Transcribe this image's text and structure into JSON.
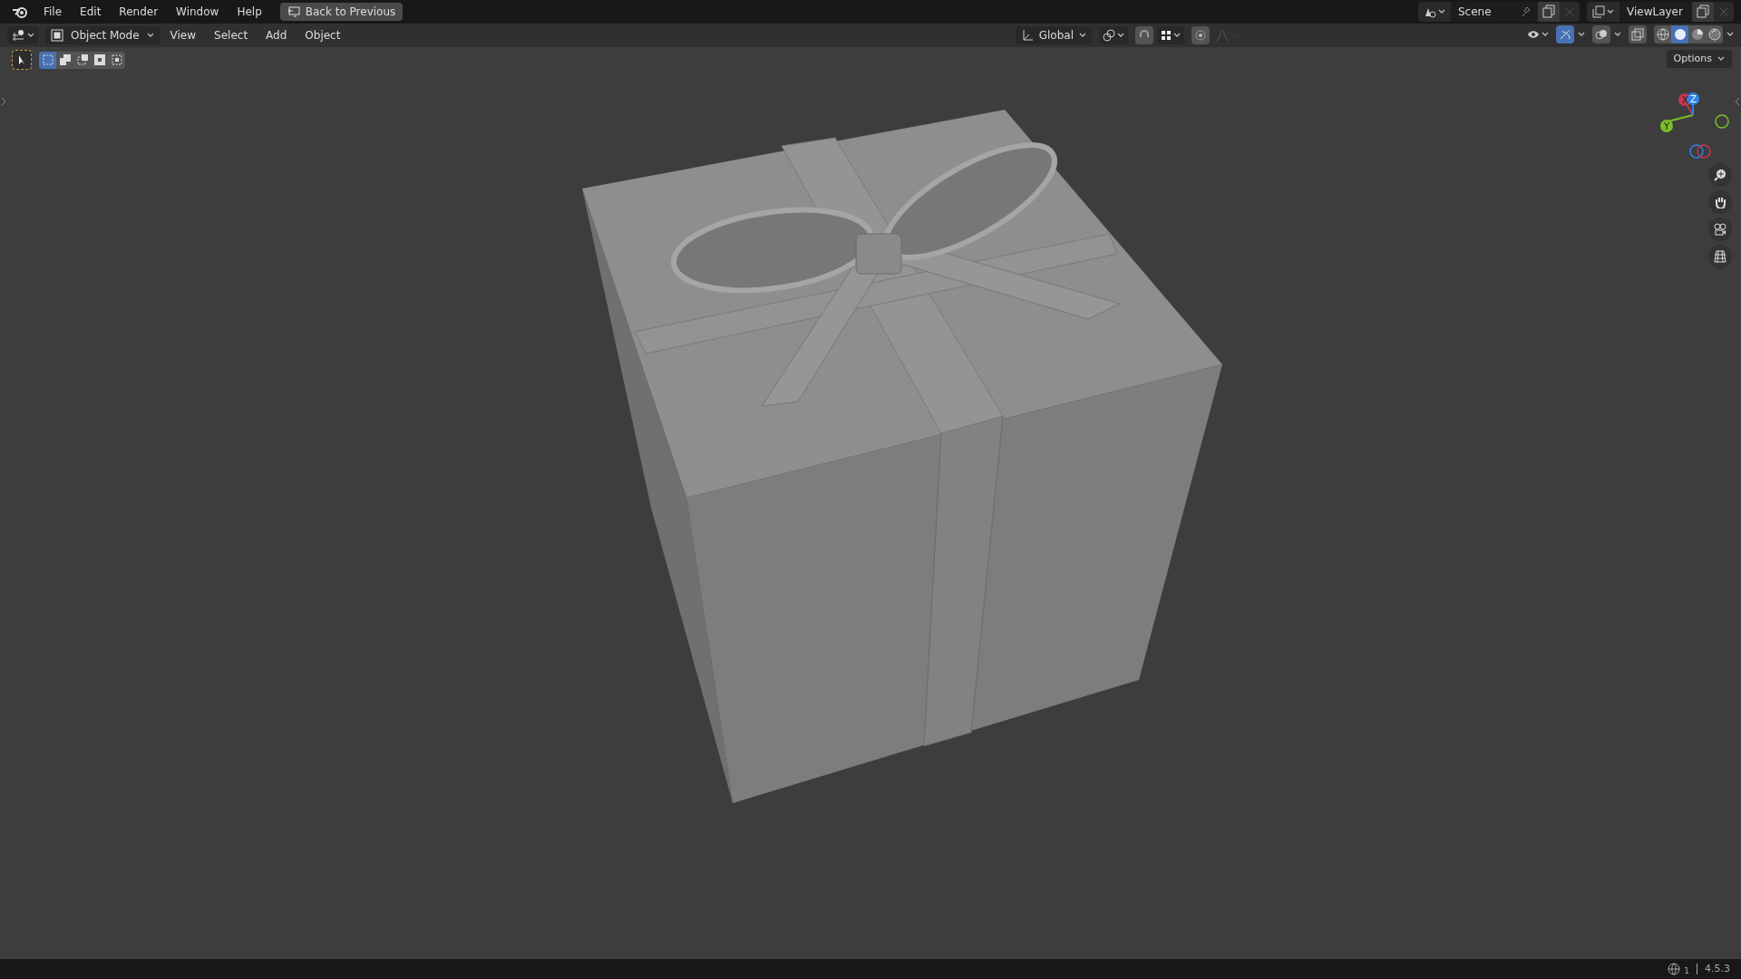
{
  "menu": [
    "File",
    "Edit",
    "Render",
    "Window",
    "Help"
  ],
  "back_button": {
    "label": "Back to Previous"
  },
  "scene": {
    "value": "Scene"
  },
  "view_layer": {
    "value": "ViewLayer"
  },
  "header": {
    "mode": "Object Mode",
    "menus": [
      "View",
      "Select",
      "Add",
      "Object"
    ],
    "orientation": "Global",
    "snap": {
      "on": false
    },
    "proportional": {
      "on": false
    },
    "gizmos": {
      "on": true
    },
    "shading": [
      {
        "kind": "wireframe",
        "selected": false
      },
      {
        "kind": "solid",
        "selected": true
      },
      {
        "kind": "material",
        "selected": false
      },
      {
        "kind": "rendered",
        "selected": false
      }
    ]
  },
  "select_modes": [
    {
      "kind": "new",
      "selected": true
    },
    {
      "kind": "extend",
      "selected": false
    },
    {
      "kind": "subtract",
      "selected": false
    },
    {
      "kind": "invert",
      "selected": false
    },
    {
      "kind": "intersect",
      "selected": false
    }
  ],
  "options": {
    "label": "Options"
  },
  "axes": [
    {
      "label": "X",
      "color": "#c4384f"
    },
    {
      "label": "Y",
      "color": "#7bbf26"
    },
    {
      "label": "Z",
      "color": "#2f83e6"
    }
  ],
  "status_bar": {
    "count": "1",
    "version": "4.5.3"
  }
}
